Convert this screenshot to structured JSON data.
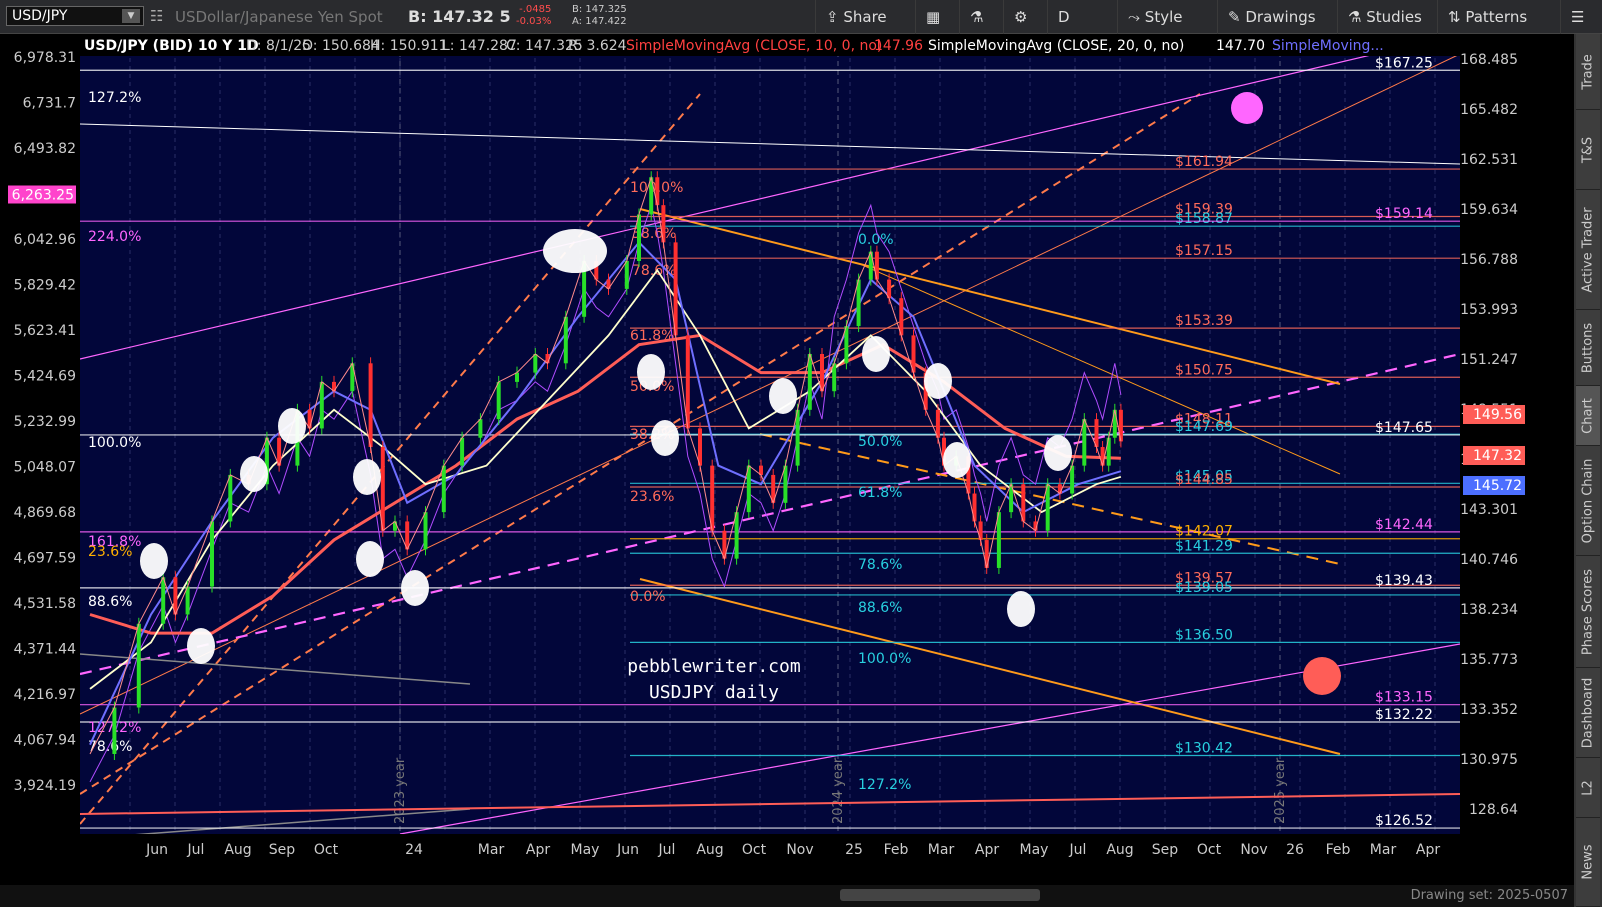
{
  "toolbar": {
    "symbol": "USD/JPY",
    "description": "USDollar/Japanese Yen Spot",
    "bid_label": "B: 147.32 5",
    "change": "-.0485",
    "change_pct": "-0.03%",
    "bid_small": "B: 147.325",
    "ask_small": "A: 147.422",
    "share": "Share",
    "period": "D",
    "style": "Style",
    "drawings": "Drawings",
    "studies": "Studies",
    "patterns": "Patterns"
  },
  "side_tabs": [
    "Trade",
    "T&S",
    "Active Trader",
    "Buttons",
    "Chart",
    "Option Chain",
    "Phase Scores",
    "Dashboard",
    "L2",
    "News"
  ],
  "footer": {
    "drawing_set": "Drawing set: 2025-0507"
  },
  "chart_data": {
    "type": "line",
    "header": {
      "symbol_info": "USD/JPY (BID) 10 Y 1D",
      "date": "D: 8/1/25",
      "open": "O: 150.684",
      "high": "H: 150.911",
      "low": "L: 147.287",
      "close": "C: 147.325",
      "range": "R: 3.624",
      "sma10": "SimpleMovingAvg (CLOSE, 10, 0, no)",
      "sma10_val": "147.96",
      "sma20": "SimpleMovingAvg (CLOSE, 20, 0, no)",
      "sma20_val": "147.70",
      "sma_more": "SimpleMoving..."
    },
    "right_axis": [
      "168.485",
      "165.482",
      "162.531",
      "159.634",
      "156.788",
      "153.993",
      "151.247",
      "148.551",
      "145.905",
      "143.301",
      "140.746",
      "138.234",
      "135.773",
      "133.352",
      "130.975",
      "128.64"
    ],
    "left_axis": [
      "6,978.31",
      "6,731.7",
      "6,493.82",
      "6,263.25",
      "6,042.96",
      "5,829.42",
      "5,623.41",
      "5,424.69",
      "5,232.99",
      "5,048.07",
      "4,869.68",
      "4,697.59",
      "4,531.58",
      "4,371.44",
      "4,216.97",
      "4,067.94",
      "3,924.19"
    ],
    "left_highlight": "6,263.25",
    "price_badges": [
      {
        "label": "149.56",
        "color": "#ff5d57"
      },
      {
        "label": "147.32",
        "color": "#ff5d57"
      },
      {
        "label": "145.72",
        "color": "#4c6fff"
      }
    ],
    "x_ticks": [
      "Jun",
      "Jul",
      "Aug",
      "Sep",
      "Oct",
      "24",
      "Mar",
      "Apr",
      "May",
      "Jun",
      "Jul",
      "Aug",
      "Oct",
      "Nov",
      "25",
      "Feb",
      "Mar",
      "Apr",
      "May",
      "Jul",
      "Aug",
      "Sep",
      "Oct",
      "Nov",
      "26",
      "Feb",
      "Mar",
      "Apr"
    ],
    "year_labels": [
      "2023 year",
      "2024 year",
      "2025 year"
    ],
    "watermark_line1": "pebblewriter.com",
    "watermark_line2": "USDJPY daily",
    "levels": [
      {
        "label": "$167.25",
        "value": 167.25,
        "color": "#ffffff"
      },
      {
        "label": "$161.94",
        "value": 161.94,
        "color": "#ff6b5a"
      },
      {
        "label": "$159.39",
        "value": 159.39,
        "color": "#ff6b5a"
      },
      {
        "label": "$158.87",
        "value": 158.87,
        "color": "#28d0e0"
      },
      {
        "label": "$159.14",
        "value": 159.14,
        "color": "#ff66ff"
      },
      {
        "label": "$157.15",
        "value": 157.15,
        "color": "#ff6b5a"
      },
      {
        "label": "$153.39",
        "value": 153.39,
        "color": "#ff6b5a"
      },
      {
        "label": "$150.75",
        "value": 150.75,
        "color": "#ff6b5a"
      },
      {
        "label": "$148.11",
        "value": 148.11,
        "color": "#ff6b5a"
      },
      {
        "label": "$147.69",
        "value": 147.69,
        "color": "#28d0e0"
      },
      {
        "label": "$147.65",
        "value": 147.65,
        "color": "#ffffff"
      },
      {
        "label": "$145.05",
        "value": 145.05,
        "color": "#28d0e0"
      },
      {
        "label": "$144.85",
        "value": 144.85,
        "color": "#ff6b5a"
      },
      {
        "label": "$142.44",
        "value": 142.44,
        "color": "#ff66ff"
      },
      {
        "label": "$142.07",
        "value": 142.07,
        "color": "#ffb000"
      },
      {
        "label": "$141.29",
        "value": 141.29,
        "color": "#28d0e0"
      },
      {
        "label": "$139.57",
        "value": 139.57,
        "color": "#ff6b5a"
      },
      {
        "label": "$139.43",
        "value": 139.43,
        "color": "#ffffff"
      },
      {
        "label": "$139.05",
        "value": 139.05,
        "color": "#28d0e0"
      },
      {
        "label": "$136.50",
        "value": 136.5,
        "color": "#28d0e0"
      },
      {
        "label": "$133.15",
        "value": 133.15,
        "color": "#ff66ff"
      },
      {
        "label": "$132.22",
        "value": 132.22,
        "color": "#ffffff"
      },
      {
        "label": "$130.42",
        "value": 130.42,
        "color": "#28d0e0"
      },
      {
        "label": "$126.52",
        "value": 126.52,
        "color": "#ffffff"
      }
    ],
    "fib_labels": [
      {
        "label": "127.2%",
        "color": "#ffffff"
      },
      {
        "label": "224.0%",
        "color": "#ff66ff"
      },
      {
        "label": "100.0%",
        "color": "#ffffff"
      },
      {
        "label": "161.8%",
        "color": "#ff66ff"
      },
      {
        "label": "23.6%",
        "color": "#ffb000"
      },
      {
        "label": "88.6%",
        "color": "#ffffff"
      },
      {
        "label": "127.2%",
        "color": "#ff66ff"
      },
      {
        "label": "78.6%",
        "color": "#ffffff"
      },
      {
        "label": "70.7%",
        "color": "#ffffff"
      },
      {
        "label": "100.0%",
        "color": "#ff6b5a"
      },
      {
        "label": "38.6%",
        "color": "#ff6b5a"
      },
      {
        "label": "78.6%",
        "color": "#ff6b5a"
      },
      {
        "label": "61.8%",
        "color": "#ff6b5a"
      },
      {
        "label": "50.0%",
        "color": "#ff6b5a"
      },
      {
        "label": "38.2%",
        "color": "#ff6b5a"
      },
      {
        "label": "23.6%",
        "color": "#ff6b5a"
      },
      {
        "label": "0.0%",
        "color": "#ff6b5a"
      },
      {
        "label": "0.0%",
        "color": "#28d0e0"
      },
      {
        "label": "50.0%",
        "color": "#28d0e0"
      },
      {
        "label": "61.8%",
        "color": "#28d0e0"
      },
      {
        "label": "78.6%",
        "color": "#28d0e0"
      },
      {
        "label": "88.6%",
        "color": "#28d0e0"
      },
      {
        "label": "100.0%",
        "color": "#28d0e0"
      },
      {
        "label": "127.2%",
        "color": "#28d0e0"
      }
    ],
    "colors": {
      "background": "#02063a",
      "sma_slow": "#ff5d57",
      "sma_mid": "#ffffcc",
      "sma_fast": "#6f6fff",
      "overlay": "#b04cff",
      "channel": "#ff7a4a",
      "target_high": "#ff66ff",
      "target_low": "#ff5d57"
    },
    "price_series": [
      [
        0,
        130.5
      ],
      [
        8,
        133
      ],
      [
        16,
        137.5
      ],
      [
        24,
        140
      ],
      [
        28,
        138
      ],
      [
        32,
        139.5
      ],
      [
        40,
        143
      ],
      [
        46,
        145.5
      ],
      [
        52,
        145
      ],
      [
        58,
        147.5
      ],
      [
        62,
        146
      ],
      [
        68,
        149
      ],
      [
        72,
        148
      ],
      [
        76,
        150.5
      ],
      [
        80,
        150
      ],
      [
        86,
        151.5
      ],
      [
        92,
        147
      ],
      [
        96,
        142.5
      ],
      [
        100,
        143
      ],
      [
        104,
        141.5
      ],
      [
        110,
        143.5
      ],
      [
        116,
        146
      ],
      [
        122,
        147.5
      ],
      [
        128,
        148.5
      ],
      [
        134,
        150.5
      ],
      [
        140,
        151
      ],
      [
        146,
        152
      ],
      [
        150,
        151.5
      ],
      [
        156,
        154
      ],
      [
        162,
        157
      ],
      [
        166,
        156
      ],
      [
        170,
        155.5
      ],
      [
        176,
        157
      ],
      [
        180,
        159.5
      ],
      [
        184,
        161.5
      ],
      [
        186,
        160
      ],
      [
        188,
        158
      ],
      [
        192,
        153
      ],
      [
        196,
        148
      ],
      [
        200,
        146
      ],
      [
        204,
        142.5
      ],
      [
        208,
        141
      ],
      [
        212,
        143.5
      ],
      [
        216,
        146
      ],
      [
        220,
        145.5
      ],
      [
        224,
        144
      ],
      [
        228,
        146
      ],
      [
        232,
        149
      ],
      [
        236,
        152
      ],
      [
        240,
        150
      ],
      [
        244,
        151.5
      ],
      [
        248,
        153.5
      ],
      [
        252,
        156
      ],
      [
        256,
        157.5
      ],
      [
        258,
        156
      ],
      [
        262,
        155
      ],
      [
        266,
        153
      ],
      [
        270,
        151
      ],
      [
        274,
        149
      ],
      [
        278,
        147.5
      ],
      [
        280,
        146
      ],
      [
        284,
        146.5
      ],
      [
        288,
        144.5
      ],
      [
        290,
        143
      ],
      [
        292,
        142
      ],
      [
        294,
        140.5
      ],
      [
        298,
        143.5
      ],
      [
        302,
        145
      ],
      [
        306,
        143
      ],
      [
        310,
        142.5
      ],
      [
        314,
        145
      ],
      [
        318,
        144.5
      ],
      [
        322,
        146
      ],
      [
        326,
        148.5
      ],
      [
        330,
        147
      ],
      [
        332,
        146
      ],
      [
        334,
        147.5
      ],
      [
        336,
        149
      ],
      [
        338,
        147.3
      ]
    ],
    "sma_slow_series": [
      [
        0,
        138
      ],
      [
        20,
        137
      ],
      [
        40,
        137
      ],
      [
        60,
        139
      ],
      [
        80,
        142
      ],
      [
        100,
        144
      ],
      [
        120,
        146
      ],
      [
        140,
        148.5
      ],
      [
        160,
        150
      ],
      [
        180,
        152.5
      ],
      [
        200,
        153
      ],
      [
        220,
        151
      ],
      [
        240,
        151
      ],
      [
        260,
        152.5
      ],
      [
        280,
        150.5
      ],
      [
        300,
        148
      ],
      [
        320,
        146.5
      ],
      [
        338,
        146.4
      ]
    ],
    "sma_mid_series": [
      [
        0,
        134
      ],
      [
        20,
        136.5
      ],
      [
        40,
        142
      ],
      [
        60,
        146
      ],
      [
        80,
        149
      ],
      [
        96,
        147
      ],
      [
        110,
        145
      ],
      [
        130,
        146
      ],
      [
        150,
        149.5
      ],
      [
        170,
        153
      ],
      [
        186,
        156.5
      ],
      [
        200,
        153
      ],
      [
        216,
        148
      ],
      [
        236,
        150
      ],
      [
        256,
        153
      ],
      [
        274,
        150
      ],
      [
        292,
        146
      ],
      [
        312,
        143.5
      ],
      [
        330,
        145
      ],
      [
        338,
        145.4
      ]
    ],
    "sma_fast_series": [
      [
        0,
        131
      ],
      [
        20,
        138
      ],
      [
        40,
        143
      ],
      [
        60,
        147.5
      ],
      [
        80,
        150
      ],
      [
        92,
        149
      ],
      [
        104,
        144
      ],
      [
        120,
        145.5
      ],
      [
        140,
        149.5
      ],
      [
        160,
        154
      ],
      [
        180,
        158
      ],
      [
        192,
        156
      ],
      [
        206,
        146
      ],
      [
        220,
        145
      ],
      [
        240,
        150.5
      ],
      [
        256,
        156
      ],
      [
        270,
        154
      ],
      [
        290,
        146
      ],
      [
        306,
        143.5
      ],
      [
        324,
        145
      ],
      [
        338,
        145.7
      ]
    ]
  }
}
